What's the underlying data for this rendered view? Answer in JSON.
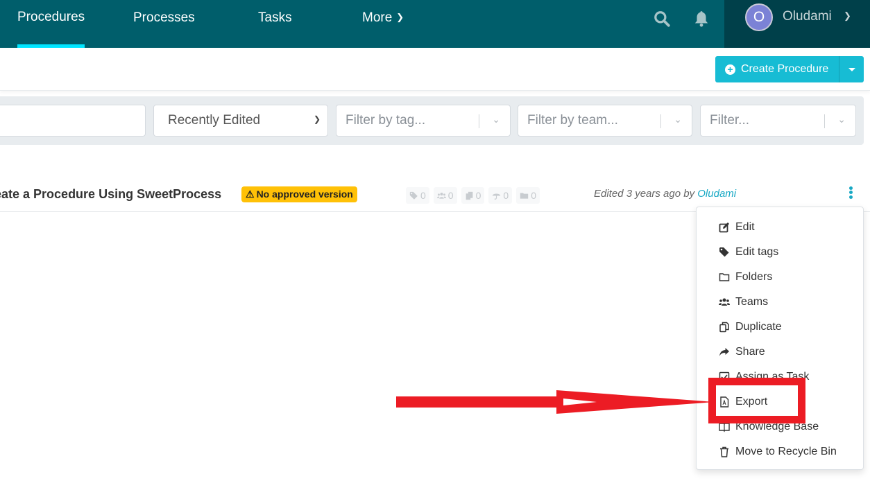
{
  "nav": {
    "items": [
      {
        "label": "Procedures",
        "active": true
      },
      {
        "label": "Processes",
        "active": false
      },
      {
        "label": "Tasks",
        "active": false
      },
      {
        "label": "More",
        "active": false
      }
    ],
    "search_icon": "search-icon",
    "bell_icon": "bell-icon",
    "user": {
      "initial": "O",
      "name": "Oludami"
    }
  },
  "toolbar": {
    "create_label": "Create Procedure",
    "accent_color": "#17bcd4"
  },
  "filters": {
    "search_value": "",
    "sort_selected": "Recently Edited",
    "tag_placeholder": "Filter by tag...",
    "team_placeholder": "Filter by team...",
    "filter_placeholder": "Filter..."
  },
  "procedures": [
    {
      "title": "eate a Procedure Using SweetProcess",
      "badge": "No approved version",
      "stats": {
        "tags": "0",
        "teams": "0",
        "docs": "0",
        "policies": "0",
        "folders": "0"
      },
      "edited_prefix": "Edited 3 years ago by",
      "edited_by": "Oludami"
    }
  ],
  "menu": {
    "items": [
      {
        "label": "Edit",
        "icon": "edit-icon"
      },
      {
        "label": "Edit tags",
        "icon": "tag-icon"
      },
      {
        "label": "Folders",
        "icon": "folder-icon"
      },
      {
        "label": "Teams",
        "icon": "users-icon"
      },
      {
        "label": "Duplicate",
        "icon": "copy-icon"
      },
      {
        "label": "Share",
        "icon": "share-icon"
      },
      {
        "label": "Assign as Task",
        "icon": "checkbox-icon"
      },
      {
        "label": "Export",
        "icon": "pdf-file-icon",
        "highlighted": true
      },
      {
        "label": "Knowledge Base",
        "icon": "book-icon"
      },
      {
        "label": "Move to Recycle Bin",
        "icon": "trash-icon"
      }
    ]
  },
  "annotation": {
    "color": "#ec1c24",
    "target": "Export"
  }
}
